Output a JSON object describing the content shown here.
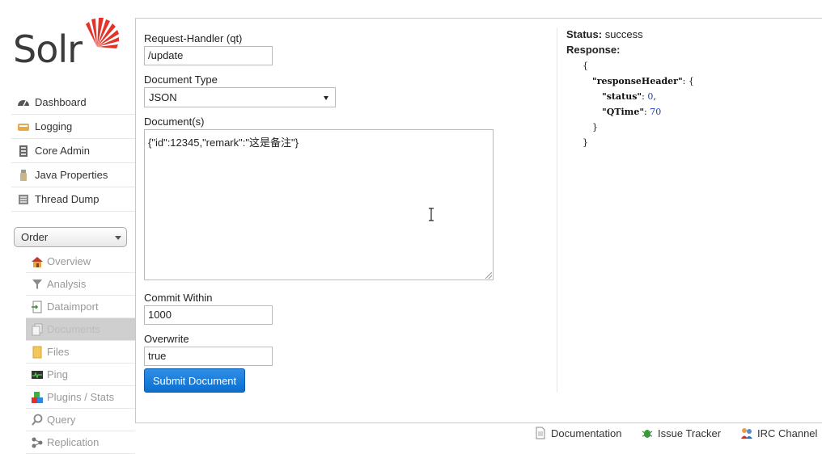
{
  "logo": {
    "text": "Solr"
  },
  "nav": {
    "items": [
      {
        "label": "Dashboard",
        "icon": "dashboard-icon"
      },
      {
        "label": "Logging",
        "icon": "logging-icon"
      },
      {
        "label": "Core Admin",
        "icon": "core-admin-icon"
      },
      {
        "label": "Java Properties",
        "icon": "java-properties-icon"
      },
      {
        "label": "Thread Dump",
        "icon": "thread-dump-icon"
      }
    ]
  },
  "core_selector": {
    "selected": "Order"
  },
  "core_nav": {
    "items": [
      {
        "label": "Overview",
        "icon": "home-icon"
      },
      {
        "label": "Analysis",
        "icon": "funnel-icon"
      },
      {
        "label": "Dataimport",
        "icon": "dataimport-icon"
      },
      {
        "label": "Documents",
        "icon": "documents-icon",
        "active": true
      },
      {
        "label": "Files",
        "icon": "files-icon"
      },
      {
        "label": "Ping",
        "icon": "ping-icon"
      },
      {
        "label": "Plugins / Stats",
        "icon": "plugins-icon"
      },
      {
        "label": "Query",
        "icon": "query-icon"
      },
      {
        "label": "Replication",
        "icon": "replication-icon"
      }
    ]
  },
  "form": {
    "request_handler_label": "Request-Handler (qt)",
    "request_handler_value": "/update",
    "document_type_label": "Document Type",
    "document_type_value": "JSON",
    "documents_label": "Document(s)",
    "documents_value": "{\"id\":12345,\"remark\":\"这是备注\"}",
    "commit_within_label": "Commit Within",
    "commit_within_value": "1000",
    "overwrite_label": "Overwrite",
    "overwrite_value": "true",
    "submit_label": "Submit Document"
  },
  "response": {
    "status_label": "Status:",
    "status_value": "success",
    "response_label": "Response:",
    "open_brace": "{",
    "header_key": "\"responseHeader\"",
    "header_open": ": {",
    "status_key": "\"status\"",
    "status_num": "0",
    "qtime_key": "\"QTime\"",
    "qtime_num": "70",
    "inner_close": "}",
    "outer_close": "}"
  },
  "footer": {
    "documentation": "Documentation",
    "issue_tracker": "Issue Tracker",
    "irc_channel": "IRC Channel"
  },
  "colors": {
    "accent": "#0c6fcf",
    "logo_red": "#e2342a"
  }
}
